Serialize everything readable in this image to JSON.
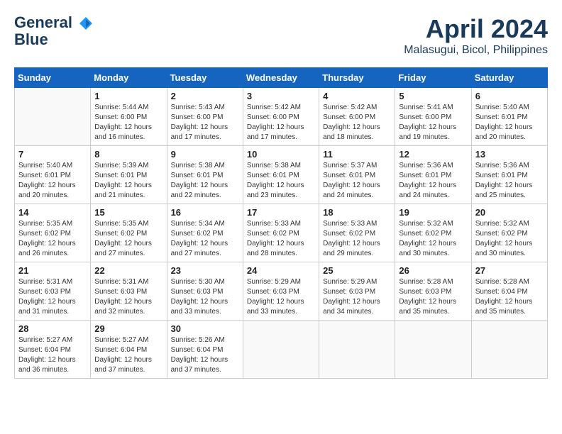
{
  "header": {
    "logo_line1": "General",
    "logo_line2": "Blue",
    "month": "April 2024",
    "location": "Malasugui, Bicol, Philippines"
  },
  "columns": [
    "Sunday",
    "Monday",
    "Tuesday",
    "Wednesday",
    "Thursday",
    "Friday",
    "Saturday"
  ],
  "weeks": [
    [
      {
        "day": "",
        "info": ""
      },
      {
        "day": "1",
        "info": "Sunrise: 5:44 AM\nSunset: 6:00 PM\nDaylight: 12 hours\nand 16 minutes."
      },
      {
        "day": "2",
        "info": "Sunrise: 5:43 AM\nSunset: 6:00 PM\nDaylight: 12 hours\nand 17 minutes."
      },
      {
        "day": "3",
        "info": "Sunrise: 5:42 AM\nSunset: 6:00 PM\nDaylight: 12 hours\nand 17 minutes."
      },
      {
        "day": "4",
        "info": "Sunrise: 5:42 AM\nSunset: 6:00 PM\nDaylight: 12 hours\nand 18 minutes."
      },
      {
        "day": "5",
        "info": "Sunrise: 5:41 AM\nSunset: 6:00 PM\nDaylight: 12 hours\nand 19 minutes."
      },
      {
        "day": "6",
        "info": "Sunrise: 5:40 AM\nSunset: 6:01 PM\nDaylight: 12 hours\nand 20 minutes."
      }
    ],
    [
      {
        "day": "7",
        "info": "Sunrise: 5:40 AM\nSunset: 6:01 PM\nDaylight: 12 hours\nand 20 minutes."
      },
      {
        "day": "8",
        "info": "Sunrise: 5:39 AM\nSunset: 6:01 PM\nDaylight: 12 hours\nand 21 minutes."
      },
      {
        "day": "9",
        "info": "Sunrise: 5:38 AM\nSunset: 6:01 PM\nDaylight: 12 hours\nand 22 minutes."
      },
      {
        "day": "10",
        "info": "Sunrise: 5:38 AM\nSunset: 6:01 PM\nDaylight: 12 hours\nand 23 minutes."
      },
      {
        "day": "11",
        "info": "Sunrise: 5:37 AM\nSunset: 6:01 PM\nDaylight: 12 hours\nand 24 minutes."
      },
      {
        "day": "12",
        "info": "Sunrise: 5:36 AM\nSunset: 6:01 PM\nDaylight: 12 hours\nand 24 minutes."
      },
      {
        "day": "13",
        "info": "Sunrise: 5:36 AM\nSunset: 6:01 PM\nDaylight: 12 hours\nand 25 minutes."
      }
    ],
    [
      {
        "day": "14",
        "info": "Sunrise: 5:35 AM\nSunset: 6:02 PM\nDaylight: 12 hours\nand 26 minutes."
      },
      {
        "day": "15",
        "info": "Sunrise: 5:35 AM\nSunset: 6:02 PM\nDaylight: 12 hours\nand 27 minutes."
      },
      {
        "day": "16",
        "info": "Sunrise: 5:34 AM\nSunset: 6:02 PM\nDaylight: 12 hours\nand 27 minutes."
      },
      {
        "day": "17",
        "info": "Sunrise: 5:33 AM\nSunset: 6:02 PM\nDaylight: 12 hours\nand 28 minutes."
      },
      {
        "day": "18",
        "info": "Sunrise: 5:33 AM\nSunset: 6:02 PM\nDaylight: 12 hours\nand 29 minutes."
      },
      {
        "day": "19",
        "info": "Sunrise: 5:32 AM\nSunset: 6:02 PM\nDaylight: 12 hours\nand 30 minutes."
      },
      {
        "day": "20",
        "info": "Sunrise: 5:32 AM\nSunset: 6:02 PM\nDaylight: 12 hours\nand 30 minutes."
      }
    ],
    [
      {
        "day": "21",
        "info": "Sunrise: 5:31 AM\nSunset: 6:03 PM\nDaylight: 12 hours\nand 31 minutes."
      },
      {
        "day": "22",
        "info": "Sunrise: 5:31 AM\nSunset: 6:03 PM\nDaylight: 12 hours\nand 32 minutes."
      },
      {
        "day": "23",
        "info": "Sunrise: 5:30 AM\nSunset: 6:03 PM\nDaylight: 12 hours\nand 33 minutes."
      },
      {
        "day": "24",
        "info": "Sunrise: 5:29 AM\nSunset: 6:03 PM\nDaylight: 12 hours\nand 33 minutes."
      },
      {
        "day": "25",
        "info": "Sunrise: 5:29 AM\nSunset: 6:03 PM\nDaylight: 12 hours\nand 34 minutes."
      },
      {
        "day": "26",
        "info": "Sunrise: 5:28 AM\nSunset: 6:03 PM\nDaylight: 12 hours\nand 35 minutes."
      },
      {
        "day": "27",
        "info": "Sunrise: 5:28 AM\nSunset: 6:04 PM\nDaylight: 12 hours\nand 35 minutes."
      }
    ],
    [
      {
        "day": "28",
        "info": "Sunrise: 5:27 AM\nSunset: 6:04 PM\nDaylight: 12 hours\nand 36 minutes."
      },
      {
        "day": "29",
        "info": "Sunrise: 5:27 AM\nSunset: 6:04 PM\nDaylight: 12 hours\nand 37 minutes."
      },
      {
        "day": "30",
        "info": "Sunrise: 5:26 AM\nSunset: 6:04 PM\nDaylight: 12 hours\nand 37 minutes."
      },
      {
        "day": "",
        "info": ""
      },
      {
        "day": "",
        "info": ""
      },
      {
        "day": "",
        "info": ""
      },
      {
        "day": "",
        "info": ""
      }
    ]
  ]
}
